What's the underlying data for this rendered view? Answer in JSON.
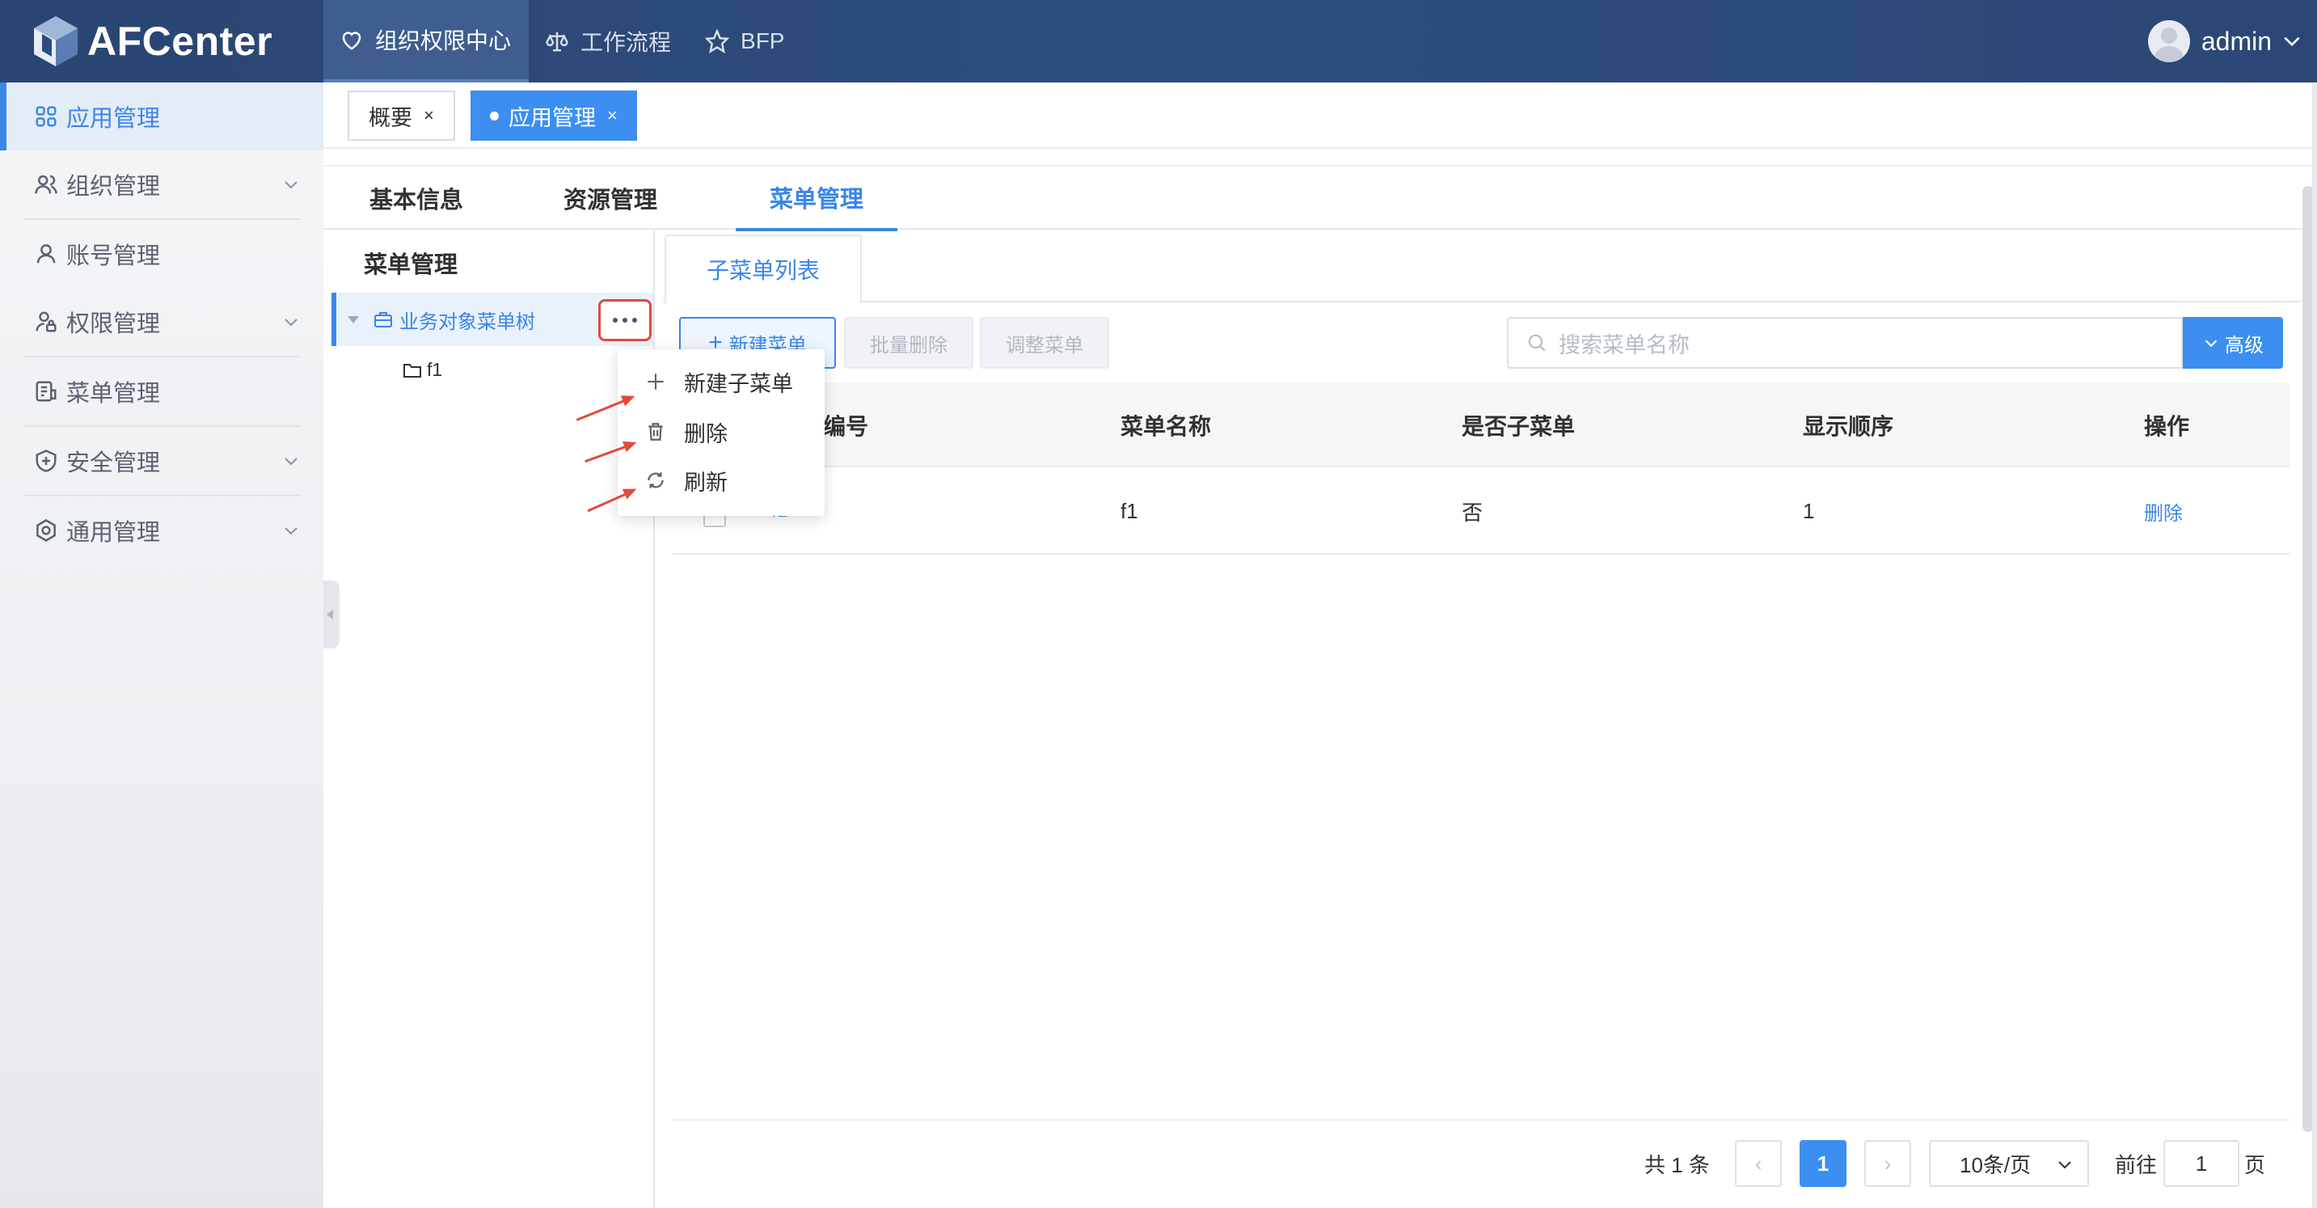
{
  "brand": {
    "name": "AFCenter"
  },
  "topnav": {
    "items": [
      {
        "label": "组织权限中心",
        "icon": "heart-shield-icon",
        "active": true
      },
      {
        "label": "工作流程",
        "icon": "scale-icon",
        "active": false
      },
      {
        "label": "BFP",
        "icon": "star-icon",
        "active": false
      }
    ]
  },
  "user": {
    "name": "admin"
  },
  "sidebar": {
    "items": [
      {
        "label": "应用管理",
        "icon": "grid-icon",
        "active": true
      },
      {
        "label": "组织管理",
        "icon": "users-icon",
        "expandable": true
      },
      {
        "label": "账号管理",
        "icon": "user-icon",
        "expandable": false
      },
      {
        "label": "权限管理",
        "icon": "user-lock-icon",
        "expandable": true
      },
      {
        "label": "菜单管理",
        "icon": "menu-doc-icon",
        "expandable": false
      },
      {
        "label": "安全管理",
        "icon": "shield-plus-icon",
        "expandable": true
      },
      {
        "label": "通用管理",
        "icon": "settings-icon",
        "expandable": true
      }
    ]
  },
  "tags": [
    {
      "label": "概要",
      "close": "×"
    },
    {
      "label": "应用管理",
      "close": "×"
    }
  ],
  "content_tabs": [
    "基本信息",
    "资源管理",
    "菜单管理"
  ],
  "tree": {
    "title": "菜单管理",
    "root_label": "业务对象菜单树",
    "child_label": "f1"
  },
  "context_menu": {
    "items": [
      {
        "label": "新建子菜单",
        "icon": "plus-icon"
      },
      {
        "label": "删除",
        "icon": "trash-icon"
      },
      {
        "label": "刷新",
        "icon": "refresh-icon"
      }
    ]
  },
  "subtab": {
    "label": "子菜单列表"
  },
  "toolbar": {
    "new_label": "新建菜单",
    "batch_delete_label": "批量删除",
    "adjust_label": "调整菜单",
    "search_placeholder": "搜索菜单名称",
    "advanced_label": "高级"
  },
  "table": {
    "columns": [
      "编号",
      "菜单名称",
      "是否子菜单",
      "显示顺序",
      "操作"
    ],
    "rows": [
      {
        "id": "f1",
        "name": "f1",
        "is_sub": "否",
        "order": "1",
        "action": "删除"
      }
    ]
  },
  "pagination": {
    "total_text": "共 1 条",
    "current_page": "1",
    "page_size": "10条/页",
    "goto_prefix": "前往",
    "goto_value": "1",
    "goto_suffix": "页",
    "prev": "‹",
    "next": "›"
  },
  "colors": {
    "primary": "#3a86e8",
    "header": "#2e4d7e",
    "annotation": "#e24a3b"
  }
}
